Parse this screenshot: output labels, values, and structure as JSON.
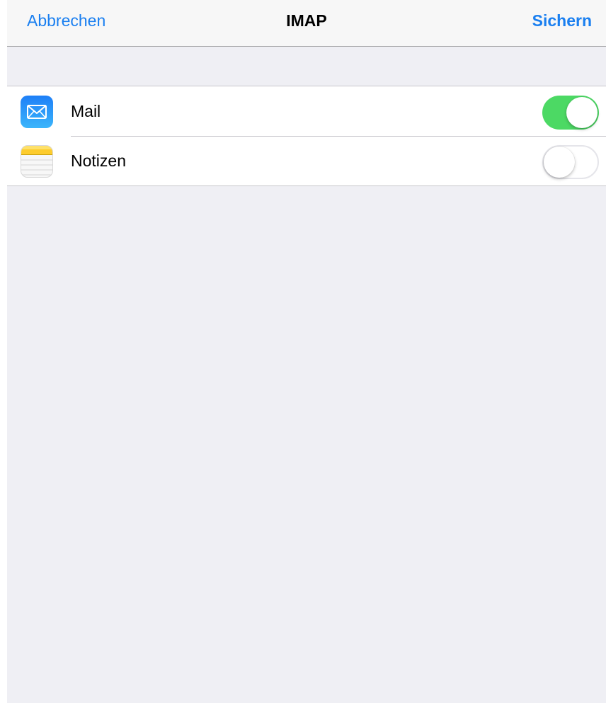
{
  "navbar": {
    "cancel_label": "Abbrechen",
    "title": "IMAP",
    "save_label": "Sichern"
  },
  "settings": {
    "items": [
      {
        "label": "Mail",
        "icon": "mail-app-icon",
        "enabled": true
      },
      {
        "label": "Notizen",
        "icon": "notes-app-icon",
        "enabled": false
      }
    ]
  },
  "colors": {
    "accent": "#1a7ff0",
    "toggle_on": "#4cd964",
    "background": "#efeff4"
  }
}
